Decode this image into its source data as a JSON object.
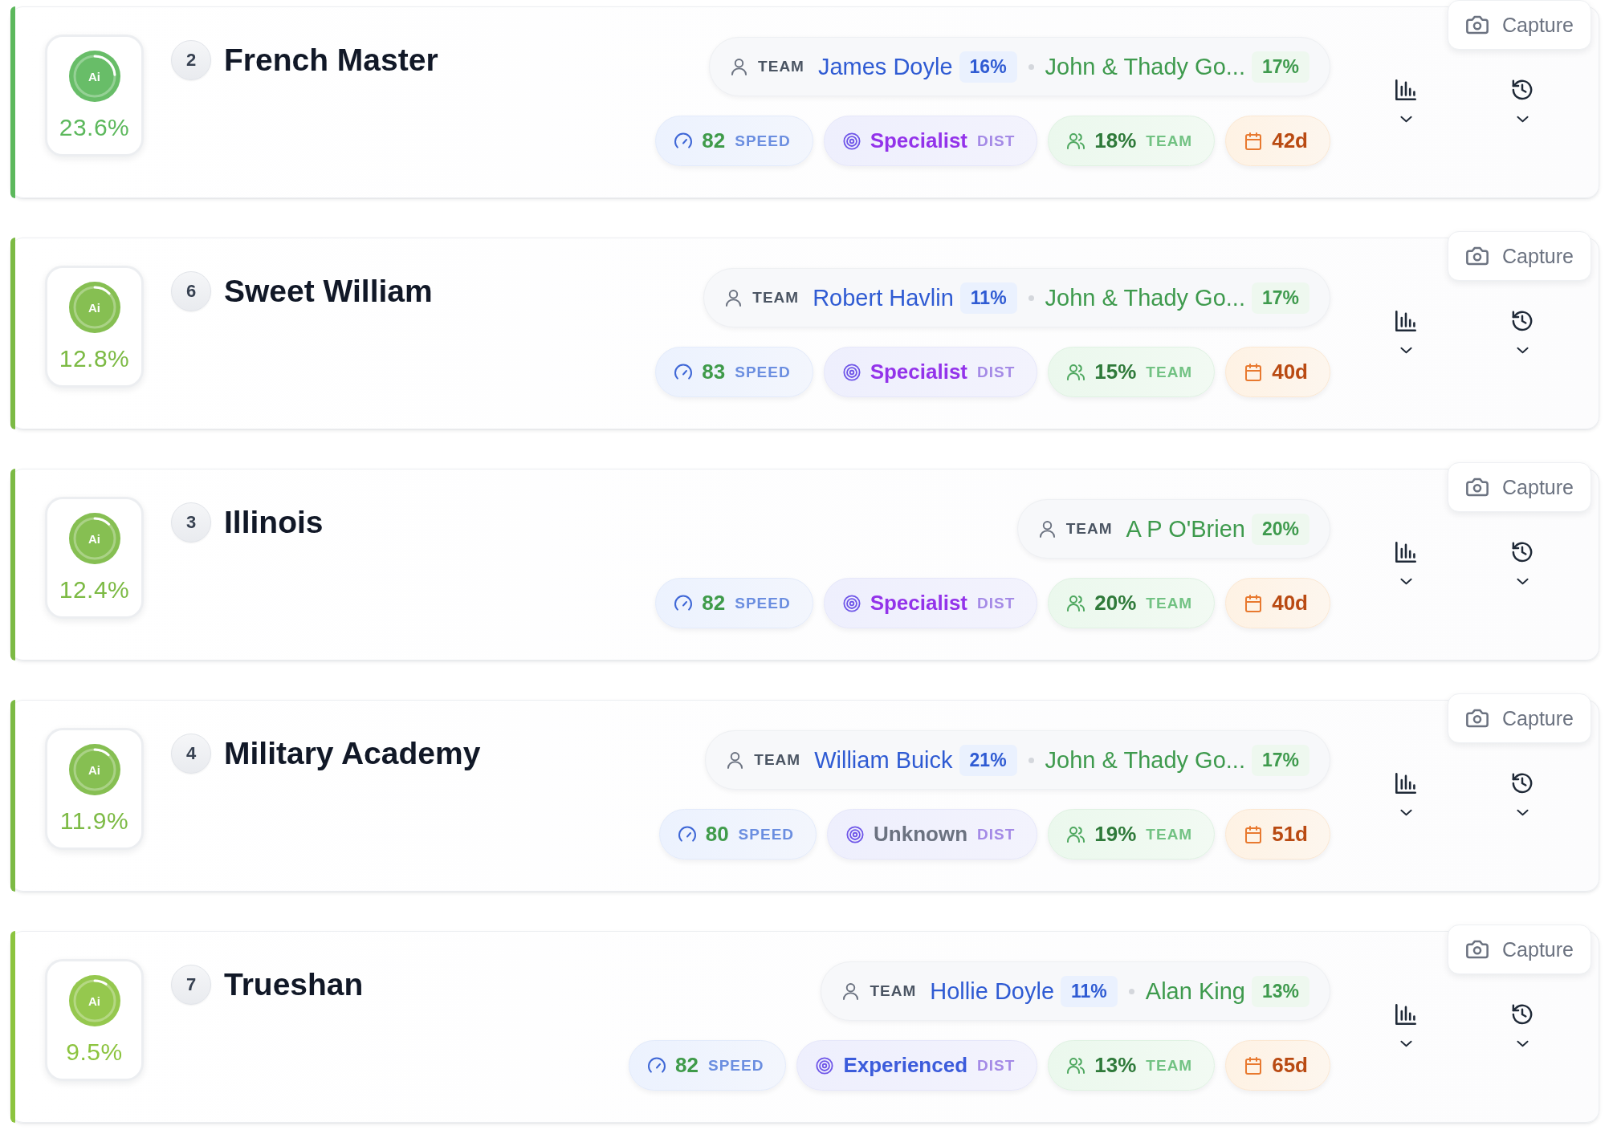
{
  "runners": [
    {
      "rank": "2",
      "name": "French Master",
      "badge": "Ai",
      "score": "23.6%",
      "level": 0.236,
      "color": "#5cb85c",
      "capture": "Capture",
      "team": {
        "label": "TEAM",
        "people": [
          {
            "kind": "jockey",
            "name": "James Doyle",
            "pct": "16%"
          },
          {
            "kind": "trainer",
            "name": "John & Thady Go...",
            "pct": "17%"
          }
        ]
      },
      "stats": [
        {
          "kind": "speed",
          "value": "82",
          "label": "SPEED"
        },
        {
          "kind": "dist",
          "value": "Specialist",
          "label": "DIST",
          "color": "#9333ea"
        },
        {
          "kind": "team",
          "value": "18%",
          "label": "TEAM"
        },
        {
          "kind": "days",
          "value": "42d"
        }
      ]
    },
    {
      "rank": "6",
      "name": "Sweet William",
      "badge": "Ai",
      "score": "12.8%",
      "level": 0.128,
      "color": "#7cba44",
      "capture": "Capture",
      "team": {
        "label": "TEAM",
        "people": [
          {
            "kind": "jockey",
            "name": "Robert Havlin",
            "pct": "11%"
          },
          {
            "kind": "trainer",
            "name": "John & Thady Go...",
            "pct": "17%"
          }
        ]
      },
      "stats": [
        {
          "kind": "speed",
          "value": "83",
          "label": "SPEED"
        },
        {
          "kind": "dist",
          "value": "Specialist",
          "label": "DIST",
          "color": "#9333ea"
        },
        {
          "kind": "team",
          "value": "15%",
          "label": "TEAM"
        },
        {
          "kind": "days",
          "value": "40d"
        }
      ]
    },
    {
      "rank": "3",
      "name": "Illinois",
      "badge": "Ai",
      "score": "12.4%",
      "level": 0.124,
      "color": "#7cba44",
      "capture": "Capture",
      "team": {
        "label": "TEAM",
        "people": [
          {
            "kind": "trainer",
            "name": "A P O'Brien",
            "pct": "20%"
          }
        ]
      },
      "stats": [
        {
          "kind": "speed",
          "value": "82",
          "label": "SPEED"
        },
        {
          "kind": "dist",
          "value": "Specialist",
          "label": "DIST",
          "color": "#9333ea"
        },
        {
          "kind": "team",
          "value": "20%",
          "label": "TEAM"
        },
        {
          "kind": "days",
          "value": "40d"
        }
      ]
    },
    {
      "rank": "4",
      "name": "Military Academy",
      "badge": "Ai",
      "score": "11.9%",
      "level": 0.119,
      "color": "#7cba44",
      "capture": "Capture",
      "team": {
        "label": "TEAM",
        "people": [
          {
            "kind": "jockey",
            "name": "William Buick",
            "pct": "21%"
          },
          {
            "kind": "trainer",
            "name": "John & Thady Go...",
            "pct": "17%"
          }
        ]
      },
      "stats": [
        {
          "kind": "speed",
          "value": "80",
          "label": "SPEED"
        },
        {
          "kind": "dist",
          "value": "Unknown",
          "label": "DIST",
          "color": "#6b7280"
        },
        {
          "kind": "team",
          "value": "19%",
          "label": "TEAM"
        },
        {
          "kind": "days",
          "value": "51d"
        }
      ]
    },
    {
      "rank": "7",
      "name": "Trueshan",
      "badge": "Ai",
      "score": "9.5%",
      "level": 0.095,
      "color": "#8cc43f",
      "capture": "Capture",
      "team": {
        "label": "TEAM",
        "people": [
          {
            "kind": "jockey",
            "name": "Hollie Doyle",
            "pct": "11%"
          },
          {
            "kind": "trainer",
            "name": "Alan King",
            "pct": "13%"
          }
        ]
      },
      "stats": [
        {
          "kind": "speed",
          "value": "82",
          "label": "SPEED"
        },
        {
          "kind": "dist",
          "value": "Experienced",
          "label": "DIST",
          "color": "#3b5bdb"
        },
        {
          "kind": "team",
          "value": "13%",
          "label": "TEAM"
        },
        {
          "kind": "days",
          "value": "65d"
        }
      ]
    }
  ]
}
